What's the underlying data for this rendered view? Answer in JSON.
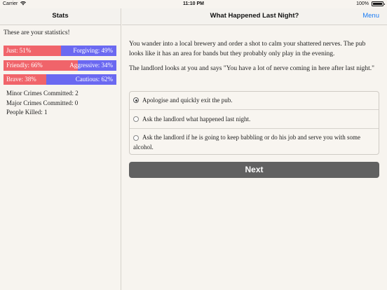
{
  "status_bar": {
    "carrier": "Carrier",
    "time": "11:10 PM",
    "battery": "100%"
  },
  "sidebar": {
    "title": "Stats",
    "intro": "These are your statistics!",
    "bars": [
      {
        "left_label": "Just: 51%",
        "right_label": "Forgiving: 49%",
        "left_percent": 51
      },
      {
        "left_label": "Friendly: 66%",
        "right_label": "Aggressive: 34%",
        "left_percent": 66
      },
      {
        "left_label": "Brave: 38%",
        "right_label": "Cautious: 62%",
        "left_percent": 38
      }
    ],
    "counters": [
      "Minor Crimes Committed: 2",
      "Major Crimes Committed: 0",
      "People Killed: 1"
    ]
  },
  "main": {
    "title": "What Happened Last Night?",
    "menu_label": "Menu",
    "paragraphs": [
      "You wander into a local brewery and order a shot to calm your shattered nerves. The pub looks like it has an area for bands but they probably only play in the evening.",
      "The landlord looks at you and says \"You have a lot of nerve coming in here after last night.\""
    ],
    "choices": [
      {
        "text": "Apologise and quickly exit the pub.",
        "selected": true
      },
      {
        "text": "Ask the landlord what happened last night.",
        "selected": false
      },
      {
        "text": "Ask the landlord if he is going to keep babbling or do his job and serve you with some alcohol.",
        "selected": false
      }
    ],
    "next_label": "Next"
  },
  "colors": {
    "left_bar": "#f0646a",
    "right_bar": "#6b69f1",
    "accent": "#1a7cf5",
    "next_button": "#616161"
  }
}
